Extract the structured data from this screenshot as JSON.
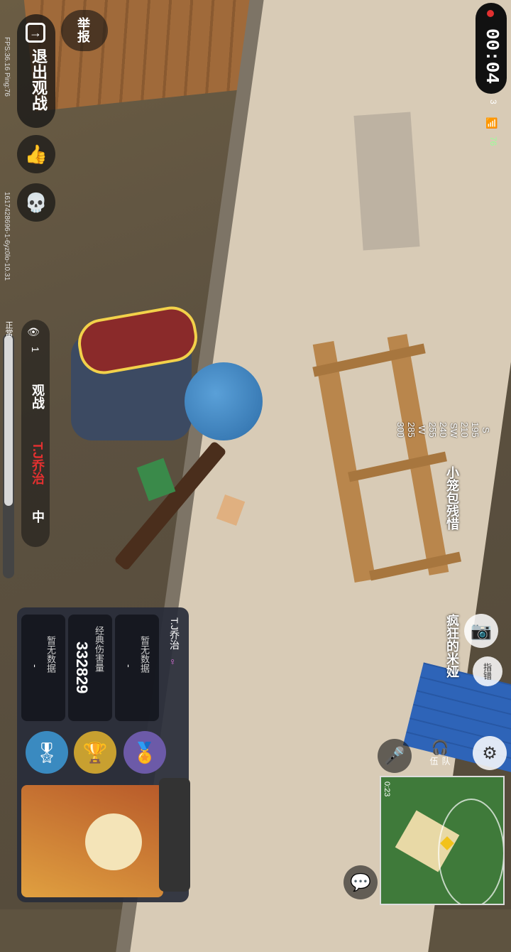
{
  "hud": {
    "timer": "00:04",
    "player_count": "3",
    "signal_value": "76",
    "fps_ping": "FPS:36.16 Ping:76",
    "match_id": "1617428696-1-6yz0lo-10.31"
  },
  "left_controls": {
    "report_label": "举报",
    "exit_label": "退出观战",
    "spectators_count": "1",
    "spectate_label": "观战",
    "spectated_player": "T.J乔治",
    "view_mode": "中",
    "status_label": "正常"
  },
  "compass": {
    "ticks": [
      "S",
      "195",
      "210",
      "SW",
      "240",
      "255",
      "W",
      "285",
      "300"
    ]
  },
  "players": {
    "teammate_name": "小笼包残惜",
    "other_name": "疯狂的米娅"
  },
  "right_controls": {
    "zoom_label": "指错",
    "team_label": "队伍",
    "minimap_time": "0:23"
  },
  "player_card": {
    "name": "T.J乔治",
    "stats": [
      {
        "label": "暂无数据",
        "value": "-"
      },
      {
        "label": "经典伤害量",
        "value": "332829"
      },
      {
        "label": "暂无数据",
        "value": "-"
      }
    ]
  },
  "colors": {
    "accent_red": "#e23030",
    "card_bg": "#282c3a",
    "minimap_green": "#3f7a3a"
  }
}
